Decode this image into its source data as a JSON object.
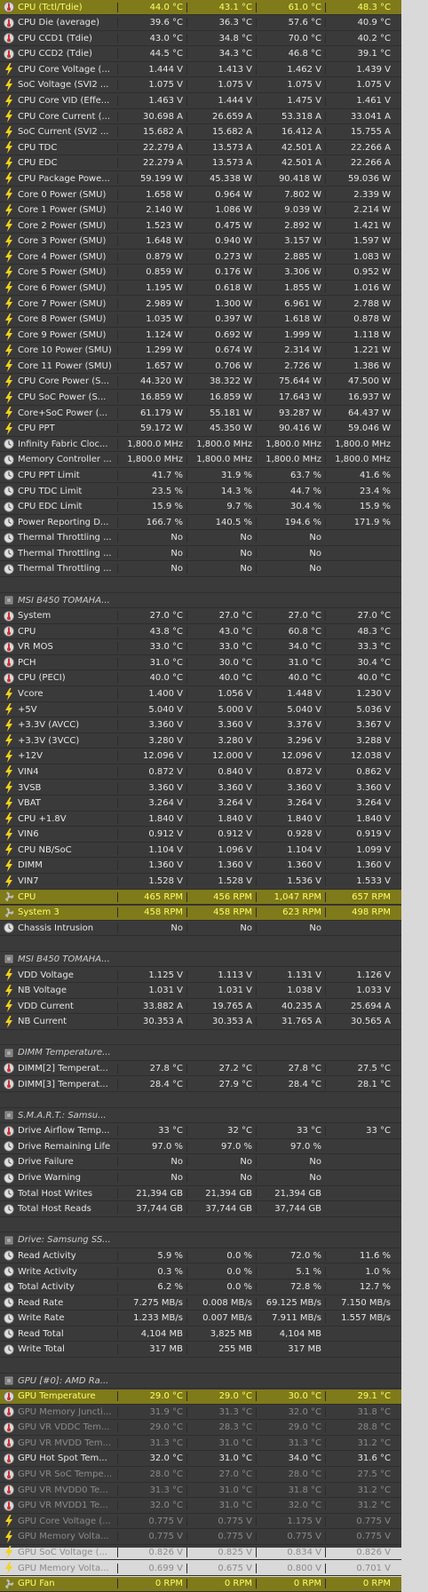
{
  "columns": [
    "current",
    "min",
    "max",
    "average"
  ],
  "accent_highlight": "#e6e828",
  "rows": [
    {
      "type": "sensor",
      "icon": "thermometer-icon",
      "label": "CPU (Tctl/Tdie)",
      "values": [
        "44.0 °C",
        "43.1 °C",
        "61.0 °C",
        "48.3 °C"
      ],
      "highlight": true
    },
    {
      "type": "sensor",
      "icon": "thermometer-icon",
      "label": "CPU Die (average)",
      "values": [
        "39.6 °C",
        "36.3 °C",
        "57.6 °C",
        "40.9 °C"
      ]
    },
    {
      "type": "sensor",
      "icon": "thermometer-icon",
      "label": "CPU CCD1 (Tdie)",
      "values": [
        "43.0 °C",
        "34.8 °C",
        "70.0 °C",
        "40.2 °C"
      ]
    },
    {
      "type": "sensor",
      "icon": "thermometer-icon",
      "label": "CPU CCD2 (Tdie)",
      "values": [
        "44.5 °C",
        "34.3 °C",
        "46.8 °C",
        "39.1 °C"
      ]
    },
    {
      "type": "sensor",
      "icon": "lightning-icon",
      "label": "CPU Core Voltage (...",
      "values": [
        "1.444 V",
        "1.413 V",
        "1.462 V",
        "1.439 V"
      ]
    },
    {
      "type": "sensor",
      "icon": "lightning-icon",
      "label": "SoC Voltage (SVI2 ...",
      "values": [
        "1.075 V",
        "1.075 V",
        "1.075 V",
        "1.075 V"
      ]
    },
    {
      "type": "sensor",
      "icon": "lightning-icon",
      "label": "CPU Core VID (Effe...",
      "values": [
        "1.463 V",
        "1.444 V",
        "1.475 V",
        "1.461 V"
      ]
    },
    {
      "type": "sensor",
      "icon": "lightning-icon",
      "label": "CPU Core Current (...",
      "values": [
        "30.698 A",
        "26.659 A",
        "53.318 A",
        "33.041 A"
      ]
    },
    {
      "type": "sensor",
      "icon": "lightning-icon",
      "label": "SoC Current (SVI2 ...",
      "values": [
        "15.682 A",
        "15.682 A",
        "16.412 A",
        "15.755 A"
      ]
    },
    {
      "type": "sensor",
      "icon": "lightning-icon",
      "label": "CPU TDC",
      "values": [
        "22.279 A",
        "13.573 A",
        "42.501 A",
        "22.266 A"
      ]
    },
    {
      "type": "sensor",
      "icon": "lightning-icon",
      "label": "CPU EDC",
      "values": [
        "22.279 A",
        "13.573 A",
        "42.501 A",
        "22.266 A"
      ]
    },
    {
      "type": "sensor",
      "icon": "lightning-icon",
      "label": "CPU Package Powe...",
      "values": [
        "59.199 W",
        "45.338 W",
        "90.418 W",
        "59.036 W"
      ]
    },
    {
      "type": "sensor",
      "icon": "lightning-icon",
      "label": "Core 0 Power (SMU)",
      "values": [
        "1.658 W",
        "0.964 W",
        "7.802 W",
        "2.339 W"
      ]
    },
    {
      "type": "sensor",
      "icon": "lightning-icon",
      "label": "Core 1 Power (SMU)",
      "values": [
        "2.140 W",
        "1.086 W",
        "9.039 W",
        "2.214 W"
      ]
    },
    {
      "type": "sensor",
      "icon": "lightning-icon",
      "label": "Core 2 Power (SMU)",
      "values": [
        "1.523 W",
        "0.475 W",
        "2.892 W",
        "1.421 W"
      ]
    },
    {
      "type": "sensor",
      "icon": "lightning-icon",
      "label": "Core 3 Power (SMU)",
      "values": [
        "1.648 W",
        "0.940 W",
        "3.157 W",
        "1.597 W"
      ]
    },
    {
      "type": "sensor",
      "icon": "lightning-icon",
      "label": "Core 4 Power (SMU)",
      "values": [
        "0.879 W",
        "0.273 W",
        "2.885 W",
        "1.083 W"
      ]
    },
    {
      "type": "sensor",
      "icon": "lightning-icon",
      "label": "Core 5 Power (SMU)",
      "values": [
        "0.859 W",
        "0.176 W",
        "3.306 W",
        "0.952 W"
      ]
    },
    {
      "type": "sensor",
      "icon": "lightning-icon",
      "label": "Core 6 Power (SMU)",
      "values": [
        "1.195 W",
        "0.618 W",
        "1.855 W",
        "1.016 W"
      ]
    },
    {
      "type": "sensor",
      "icon": "lightning-icon",
      "label": "Core 7 Power (SMU)",
      "values": [
        "2.989 W",
        "1.300 W",
        "6.961 W",
        "2.788 W"
      ]
    },
    {
      "type": "sensor",
      "icon": "lightning-icon",
      "label": "Core 8 Power (SMU)",
      "values": [
        "1.035 W",
        "0.397 W",
        "1.618 W",
        "0.878 W"
      ]
    },
    {
      "type": "sensor",
      "icon": "lightning-icon",
      "label": "Core 9 Power (SMU)",
      "values": [
        "1.124 W",
        "0.692 W",
        "1.999 W",
        "1.118 W"
      ]
    },
    {
      "type": "sensor",
      "icon": "lightning-icon",
      "label": "Core 10 Power (SMU)",
      "values": [
        "1.299 W",
        "0.674 W",
        "2.314 W",
        "1.221 W"
      ]
    },
    {
      "type": "sensor",
      "icon": "lightning-icon",
      "label": "Core 11 Power (SMU)",
      "values": [
        "1.657 W",
        "0.706 W",
        "2.726 W",
        "1.386 W"
      ]
    },
    {
      "type": "sensor",
      "icon": "lightning-icon",
      "label": "CPU Core Power (S...",
      "values": [
        "44.320 W",
        "38.322 W",
        "75.644 W",
        "47.500 W"
      ]
    },
    {
      "type": "sensor",
      "icon": "lightning-icon",
      "label": "CPU SoC Power (S...",
      "values": [
        "16.859 W",
        "16.859 W",
        "17.643 W",
        "16.937 W"
      ]
    },
    {
      "type": "sensor",
      "icon": "lightning-icon",
      "label": "Core+SoC Power (...",
      "values": [
        "61.179 W",
        "55.181 W",
        "93.287 W",
        "64.437 W"
      ]
    },
    {
      "type": "sensor",
      "icon": "lightning-icon",
      "label": "CPU PPT",
      "values": [
        "59.172 W",
        "45.350 W",
        "90.416 W",
        "59.046 W"
      ]
    },
    {
      "type": "sensor",
      "icon": "clock-icon",
      "label": "Infinity Fabric Cloc...",
      "values": [
        "1,800.0 MHz",
        "1,800.0 MHz",
        "1,800.0 MHz",
        "1,800.0 MHz"
      ]
    },
    {
      "type": "sensor",
      "icon": "clock-icon",
      "label": "Memory Controller ...",
      "values": [
        "1,800.0 MHz",
        "1,800.0 MHz",
        "1,800.0 MHz",
        "1,800.0 MHz"
      ]
    },
    {
      "type": "sensor",
      "icon": "clock-icon",
      "label": "CPU PPT Limit",
      "values": [
        "41.7 %",
        "31.9 %",
        "63.7 %",
        "41.6 %"
      ]
    },
    {
      "type": "sensor",
      "icon": "clock-icon",
      "label": "CPU TDC Limit",
      "values": [
        "23.5 %",
        "14.3 %",
        "44.7 %",
        "23.4 %"
      ]
    },
    {
      "type": "sensor",
      "icon": "clock-icon",
      "label": "CPU EDC Limit",
      "values": [
        "15.9 %",
        "9.7 %",
        "30.4 %",
        "15.9 %"
      ]
    },
    {
      "type": "sensor",
      "icon": "clock-icon",
      "label": "Power Reporting D...",
      "values": [
        "166.7 %",
        "140.5 %",
        "194.6 %",
        "171.9 %"
      ]
    },
    {
      "type": "sensor",
      "icon": "clock-icon",
      "label": "Thermal Throttling ...",
      "values": [
        "No",
        "No",
        "No",
        ""
      ]
    },
    {
      "type": "sensor",
      "icon": "clock-icon",
      "label": "Thermal Throttling ...",
      "values": [
        "No",
        "No",
        "No",
        ""
      ]
    },
    {
      "type": "sensor",
      "icon": "clock-icon",
      "label": "Thermal Throttling ...",
      "values": [
        "No",
        "No",
        "No",
        ""
      ]
    },
    {
      "type": "blank"
    },
    {
      "type": "group",
      "icon": "chip-icon",
      "label": "MSI B450 TOMAHA..."
    },
    {
      "type": "sensor",
      "icon": "thermometer-icon",
      "label": "System",
      "values": [
        "27.0 °C",
        "27.0 °C",
        "27.0 °C",
        "27.0 °C"
      ]
    },
    {
      "type": "sensor",
      "icon": "thermometer-icon",
      "label": "CPU",
      "values": [
        "43.8 °C",
        "43.0 °C",
        "60.8 °C",
        "48.3 °C"
      ]
    },
    {
      "type": "sensor",
      "icon": "thermometer-icon",
      "label": "VR MOS",
      "values": [
        "33.0 °C",
        "33.0 °C",
        "34.0 °C",
        "33.3 °C"
      ]
    },
    {
      "type": "sensor",
      "icon": "thermometer-icon",
      "label": "PCH",
      "values": [
        "31.0 °C",
        "30.0 °C",
        "31.0 °C",
        "30.4 °C"
      ]
    },
    {
      "type": "sensor",
      "icon": "thermometer-icon",
      "label": "CPU (PECI)",
      "values": [
        "40.0 °C",
        "40.0 °C",
        "40.0 °C",
        "40.0 °C"
      ]
    },
    {
      "type": "sensor",
      "icon": "lightning-icon",
      "label": "Vcore",
      "values": [
        "1.400 V",
        "1.056 V",
        "1.448 V",
        "1.230 V"
      ]
    },
    {
      "type": "sensor",
      "icon": "lightning-icon",
      "label": "+5V",
      "values": [
        "5.040 V",
        "5.000 V",
        "5.040 V",
        "5.036 V"
      ]
    },
    {
      "type": "sensor",
      "icon": "lightning-icon",
      "label": "+3.3V (AVCC)",
      "values": [
        "3.360 V",
        "3.360 V",
        "3.376 V",
        "3.367 V"
      ]
    },
    {
      "type": "sensor",
      "icon": "lightning-icon",
      "label": "+3.3V (3VCC)",
      "values": [
        "3.280 V",
        "3.280 V",
        "3.296 V",
        "3.288 V"
      ]
    },
    {
      "type": "sensor",
      "icon": "lightning-icon",
      "label": "+12V",
      "values": [
        "12.096 V",
        "12.000 V",
        "12.096 V",
        "12.038 V"
      ]
    },
    {
      "type": "sensor",
      "icon": "lightning-icon",
      "label": "VIN4",
      "values": [
        "0.872 V",
        "0.840 V",
        "0.872 V",
        "0.862 V"
      ]
    },
    {
      "type": "sensor",
      "icon": "lightning-icon",
      "label": "3VSB",
      "values": [
        "3.360 V",
        "3.360 V",
        "3.360 V",
        "3.360 V"
      ]
    },
    {
      "type": "sensor",
      "icon": "lightning-icon",
      "label": "VBAT",
      "values": [
        "3.264 V",
        "3.264 V",
        "3.264 V",
        "3.264 V"
      ]
    },
    {
      "type": "sensor",
      "icon": "lightning-icon",
      "label": "CPU +1.8V",
      "values": [
        "1.840 V",
        "1.840 V",
        "1.840 V",
        "1.840 V"
      ]
    },
    {
      "type": "sensor",
      "icon": "lightning-icon",
      "label": "VIN6",
      "values": [
        "0.912 V",
        "0.912 V",
        "0.928 V",
        "0.919 V"
      ]
    },
    {
      "type": "sensor",
      "icon": "lightning-icon",
      "label": "CPU NB/SoC",
      "values": [
        "1.104 V",
        "1.096 V",
        "1.104 V",
        "1.099 V"
      ]
    },
    {
      "type": "sensor",
      "icon": "lightning-icon",
      "label": "DIMM",
      "values": [
        "1.360 V",
        "1.360 V",
        "1.360 V",
        "1.360 V"
      ]
    },
    {
      "type": "sensor",
      "icon": "lightning-icon",
      "label": "VIN7",
      "values": [
        "1.528 V",
        "1.528 V",
        "1.536 V",
        "1.533 V"
      ]
    },
    {
      "type": "sensor",
      "icon": "fan-icon",
      "label": "CPU",
      "values": [
        "465 RPM",
        "456 RPM",
        "1,047 RPM",
        "657 RPM"
      ],
      "highlight": true
    },
    {
      "type": "sensor",
      "icon": "fan-icon",
      "label": "System 3",
      "values": [
        "458 RPM",
        "458 RPM",
        "623 RPM",
        "498 RPM"
      ],
      "highlight": true
    },
    {
      "type": "sensor",
      "icon": "clock-icon",
      "label": "Chassis Intrusion",
      "values": [
        "No",
        "No",
        "No",
        ""
      ]
    },
    {
      "type": "blank"
    },
    {
      "type": "group",
      "icon": "chip-icon",
      "label": "MSI B450 TOMAHA..."
    },
    {
      "type": "sensor",
      "icon": "lightning-icon",
      "label": "VDD Voltage",
      "values": [
        "1.125 V",
        "1.113 V",
        "1.131 V",
        "1.126 V"
      ]
    },
    {
      "type": "sensor",
      "icon": "lightning-icon",
      "label": "NB Voltage",
      "values": [
        "1.031 V",
        "1.031 V",
        "1.038 V",
        "1.033 V"
      ]
    },
    {
      "type": "sensor",
      "icon": "lightning-icon",
      "label": "VDD Current",
      "values": [
        "33.882 A",
        "19.765 A",
        "40.235 A",
        "25.694 A"
      ]
    },
    {
      "type": "sensor",
      "icon": "lightning-icon",
      "label": "NB Current",
      "values": [
        "30.353 A",
        "30.353 A",
        "31.765 A",
        "30.565 A"
      ]
    },
    {
      "type": "blank"
    },
    {
      "type": "group",
      "icon": "chip-icon",
      "label": "DIMM Temperature..."
    },
    {
      "type": "sensor",
      "icon": "thermometer-icon",
      "label": "DIMM[2] Temperat...",
      "values": [
        "27.8 °C",
        "27.2 °C",
        "27.8 °C",
        "27.5 °C"
      ]
    },
    {
      "type": "sensor",
      "icon": "thermometer-icon",
      "label": "DIMM[3] Temperat...",
      "values": [
        "28.4 °C",
        "27.9 °C",
        "28.4 °C",
        "28.1 °C"
      ]
    },
    {
      "type": "blank"
    },
    {
      "type": "group",
      "icon": "chip-icon",
      "label": "S.M.A.R.T.: Samsu..."
    },
    {
      "type": "sensor",
      "icon": "thermometer-icon",
      "label": "Drive Airflow Temp...",
      "values": [
        "33 °C",
        "32 °C",
        "33 °C",
        "33 °C"
      ]
    },
    {
      "type": "sensor",
      "icon": "clock-icon",
      "label": "Drive Remaining Life",
      "values": [
        "97.0 %",
        "97.0 %",
        "97.0 %",
        ""
      ]
    },
    {
      "type": "sensor",
      "icon": "clock-icon",
      "label": "Drive Failure",
      "values": [
        "No",
        "No",
        "No",
        ""
      ]
    },
    {
      "type": "sensor",
      "icon": "clock-icon",
      "label": "Drive Warning",
      "values": [
        "No",
        "No",
        "No",
        ""
      ]
    },
    {
      "type": "sensor",
      "icon": "clock-icon",
      "label": "Total Host Writes",
      "values": [
        "21,394 GB",
        "21,394 GB",
        "21,394 GB",
        ""
      ]
    },
    {
      "type": "sensor",
      "icon": "clock-icon",
      "label": "Total Host Reads",
      "values": [
        "37,744 GB",
        "37,744 GB",
        "37,744 GB",
        ""
      ]
    },
    {
      "type": "blank"
    },
    {
      "type": "group",
      "icon": "chip-icon",
      "label": "Drive: Samsung SS..."
    },
    {
      "type": "sensor",
      "icon": "clock-icon",
      "label": "Read Activity",
      "values": [
        "5.9 %",
        "0.0 %",
        "72.0 %",
        "11.6 %"
      ]
    },
    {
      "type": "sensor",
      "icon": "clock-icon",
      "label": "Write Activity",
      "values": [
        "0.3 %",
        "0.0 %",
        "5.1 %",
        "1.0 %"
      ]
    },
    {
      "type": "sensor",
      "icon": "clock-icon",
      "label": "Total Activity",
      "values": [
        "6.2 %",
        "0.0 %",
        "72.8 %",
        "12.7 %"
      ]
    },
    {
      "type": "sensor",
      "icon": "clock-icon",
      "label": "Read Rate",
      "values": [
        "7.275 MB/s",
        "0.008 MB/s",
        "69.125 MB/s",
        "7.150 MB/s"
      ]
    },
    {
      "type": "sensor",
      "icon": "clock-icon",
      "label": "Write Rate",
      "values": [
        "1.233 MB/s",
        "0.007 MB/s",
        "7.911 MB/s",
        "1.557 MB/s"
      ]
    },
    {
      "type": "sensor",
      "icon": "clock-icon",
      "label": "Read Total",
      "values": [
        "4,104 MB",
        "3,825 MB",
        "4,104 MB",
        ""
      ]
    },
    {
      "type": "sensor",
      "icon": "clock-icon",
      "label": "Write Total",
      "values": [
        "317 MB",
        "255 MB",
        "317 MB",
        ""
      ]
    },
    {
      "type": "blank"
    },
    {
      "type": "group",
      "icon": "chip-icon",
      "label": "GPU [#0]: AMD Ra..."
    },
    {
      "type": "sensor",
      "icon": "thermometer-icon",
      "label": "GPU Temperature",
      "values": [
        "29.0 °C",
        "29.0 °C",
        "30.0 °C",
        "29.1 °C"
      ],
      "highlight": true
    },
    {
      "type": "sensor",
      "icon": "thermometer-icon",
      "label": "GPU Memory Juncti...",
      "values": [
        "31.9 °C",
        "31.3 °C",
        "32.0 °C",
        "31.8 °C"
      ],
      "faded": true
    },
    {
      "type": "sensor",
      "icon": "thermometer-icon",
      "label": "GPU VR VDDC Tem...",
      "values": [
        "29.0 °C",
        "28.3 °C",
        "29.0 °C",
        "28.8 °C"
      ],
      "faded": true
    },
    {
      "type": "sensor",
      "icon": "thermometer-icon",
      "label": "GPU VR MVDD Tem...",
      "values": [
        "31.3 °C",
        "31.0 °C",
        "31.3 °C",
        "31.2 °C"
      ],
      "faded": true
    },
    {
      "type": "sensor",
      "icon": "thermometer-icon",
      "label": "GPU Hot Spot Tem...",
      "values": [
        "32.0 °C",
        "31.0 °C",
        "34.0 °C",
        "31.6 °C"
      ]
    },
    {
      "type": "sensor",
      "icon": "thermometer-icon",
      "label": "GPU VR SoC Tempe...",
      "values": [
        "28.0 °C",
        "27.0 °C",
        "28.0 °C",
        "27.5 °C"
      ],
      "faded": true
    },
    {
      "type": "sensor",
      "icon": "thermometer-icon",
      "label": "GPU VR MVDD0 Te...",
      "values": [
        "31.3 °C",
        "31.0 °C",
        "31.8 °C",
        "31.2 °C"
      ],
      "faded": true
    },
    {
      "type": "sensor",
      "icon": "thermometer-icon",
      "label": "GPU VR MVDD1 Te...",
      "values": [
        "32.0 °C",
        "31.0 °C",
        "32.0 °C",
        "31.2 °C"
      ],
      "faded": true
    },
    {
      "type": "sensor",
      "icon": "lightning-icon",
      "label": "GPU Core Voltage (...",
      "values": [
        "0.775 V",
        "0.775 V",
        "1.175 V",
        "0.775 V"
      ],
      "faded": true
    },
    {
      "type": "sensor",
      "icon": "lightning-icon",
      "label": "GPU Memory Volta...",
      "values": [
        "0.775 V",
        "0.775 V",
        "0.775 V",
        "0.775 V"
      ],
      "faded": true
    },
    {
      "type": "sensor",
      "icon": "lightning-icon",
      "label": "GPU SoC Voltage (...",
      "values": [
        "0.826 V",
        "0.825 V",
        "0.834 V",
        "0.826 V"
      ],
      "faded": true
    },
    {
      "type": "sensor",
      "icon": "lightning-icon",
      "label": "GPU Memory Volta...",
      "values": [
        "0.699 V",
        "0.675 V",
        "0.800 V",
        "0.701 V"
      ],
      "faded": true
    },
    {
      "type": "sensor",
      "icon": "fan-icon",
      "label": "GPU Fan",
      "values": [
        "0 RPM",
        "0 RPM",
        "0 RPM",
        "0 RPM"
      ],
      "highlight": true
    }
  ]
}
